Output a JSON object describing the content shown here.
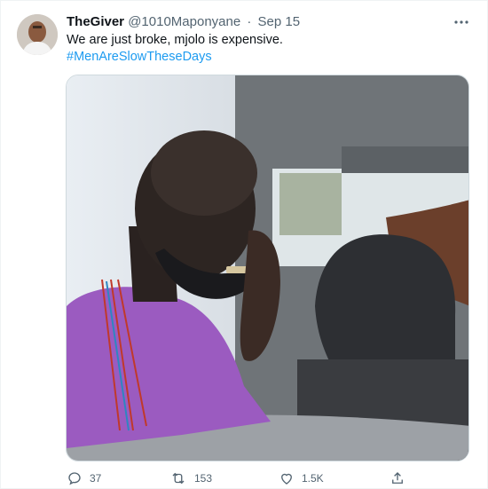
{
  "tweet": {
    "author_name": "TheGiver",
    "author_handle": "@1010Maponyane",
    "separator": "·",
    "date": "Sep 15",
    "text": "We are just broke, mjolo is expensive.",
    "hashtag": "#MenAreSlowTheseDays"
  },
  "actions": {
    "replies": "37",
    "retweets": "153",
    "likes": "1.5K"
  },
  "colors": {
    "link": "#1d9bf0",
    "secondary_text": "#536471",
    "primary_text": "#0f1419"
  }
}
